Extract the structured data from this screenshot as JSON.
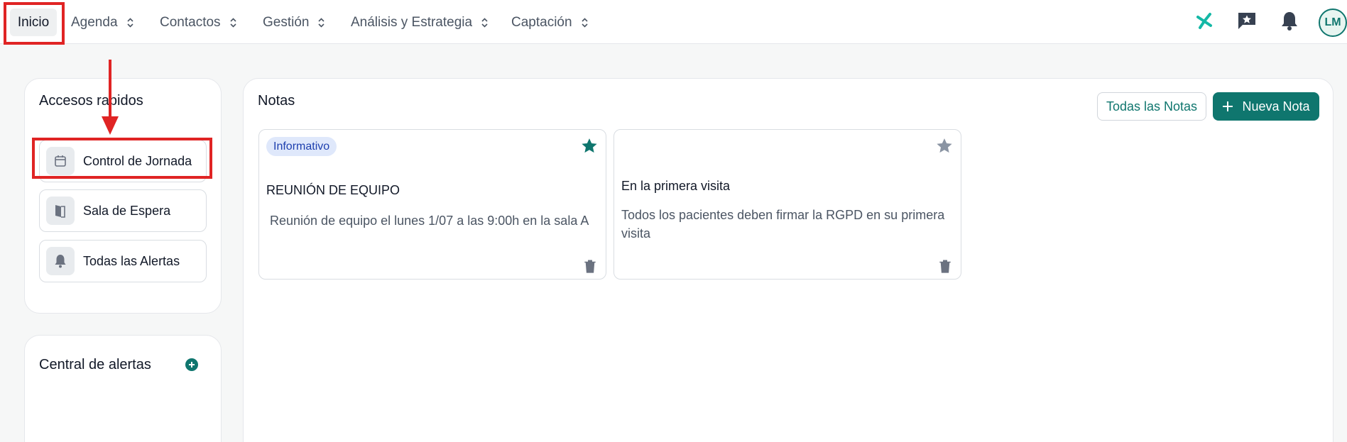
{
  "nav": {
    "items": [
      {
        "label": "Inicio"
      },
      {
        "label": "Agenda"
      },
      {
        "label": "Contactos"
      },
      {
        "label": "Gestión"
      },
      {
        "label": "Análisis y Estrategia"
      },
      {
        "label": "Captación"
      }
    ]
  },
  "header": {
    "icons": [
      "docplanner-logo-icon",
      "feedback-star-icon",
      "bell-icon"
    ],
    "avatar_initials": "LM"
  },
  "quick_access": {
    "title": "Accesos rapidos",
    "items": [
      {
        "label": "Control de Jornada",
        "icon": "calendar-icon"
      },
      {
        "label": "Sala de Espera",
        "icon": "door-icon"
      },
      {
        "label": "Todas las Alertas",
        "icon": "bell-icon"
      }
    ]
  },
  "alerts_center": {
    "title": "Central de alertas"
  },
  "notes": {
    "title": "Notas",
    "all_notes_label": "Todas las Notas",
    "new_note_label": "Nueva Nota",
    "cards": [
      {
        "badge": "Informativo",
        "title": "REUNIÓN DE EQUIPO",
        "body": "Reunión de equipo el lunes 1/07 a las 9:00h en la sala A",
        "starred": true
      },
      {
        "badge": "",
        "title": "En la primera visita",
        "body": "Todos los pacientes deben firmar la RGPD en su primera visita",
        "starred": false
      }
    ]
  },
  "colors": {
    "brand": "#0f766e",
    "annotation_red": "#e02424",
    "badge_bg": "#dfe8fb"
  }
}
